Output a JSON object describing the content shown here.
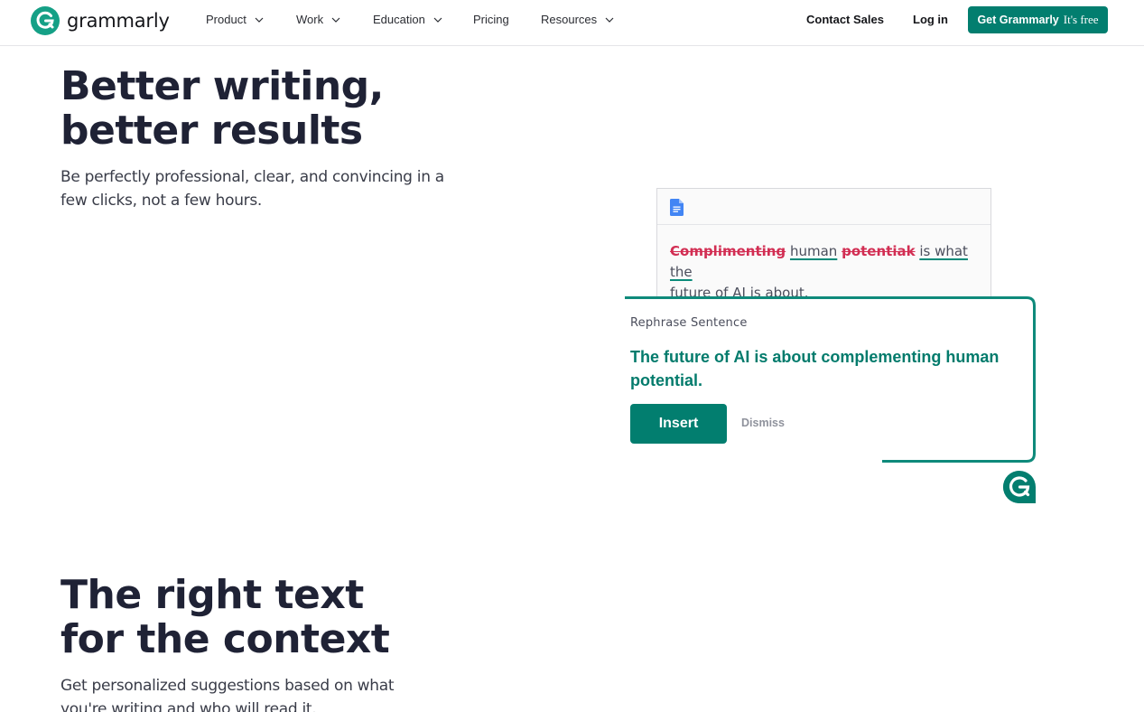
{
  "nav": {
    "brand": "grammarly",
    "items": [
      {
        "label": "Product",
        "dropdown": true
      },
      {
        "label": "Work",
        "dropdown": true
      },
      {
        "label": "Education",
        "dropdown": true
      },
      {
        "label": "Pricing",
        "dropdown": false
      },
      {
        "label": "Resources",
        "dropdown": true
      }
    ],
    "contact_sales": "Contact Sales",
    "login": "Log in",
    "cta_main": "Get Grammarly",
    "cta_sub": "It's free"
  },
  "hero": {
    "title_line1": "Better writing,",
    "title_line2": "better results",
    "subtitle": "Be perfectly professional, clear, and convincing in a few clicks, not a few hours."
  },
  "doc_card": {
    "strike1": "Complimenting",
    "word_human": "human",
    "strike2": "potentiak",
    "rest1": "is what the",
    "rest2": "future of AI is about."
  },
  "suggestion": {
    "label": "Rephrase Sentence",
    "text": "The future of AI is about complementing human potential.",
    "insert": "Insert",
    "dismiss": "Dismiss"
  },
  "section2": {
    "title_line1": "The right text",
    "title_line2": "for the context",
    "subtitle": "Get personalized suggestions based on what you're writing and who will read it."
  },
  "colors": {
    "brand_green": "#027e6f",
    "error_red": "#d22e53",
    "heading": "#1f2235"
  }
}
